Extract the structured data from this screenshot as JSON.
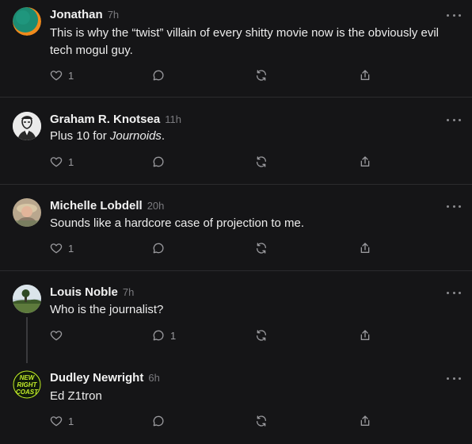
{
  "posts": [
    {
      "author": "Jonathan",
      "time": "7h",
      "text": "This is why the “twist” villain of every shitty movie now is the obviously evil tech mogul guy.",
      "likes": "1",
      "replies": "",
      "avatar": "teal-orange-circle"
    },
    {
      "author": "Graham R. Knotsea",
      "time": "11h",
      "text_plain": "Plus 10 for ",
      "text_italic": "Journoids",
      "text_end": ".",
      "likes": "1",
      "replies": "",
      "avatar": "sketch-portrait"
    },
    {
      "author": "Michelle Lobdell",
      "time": "20h",
      "text": "Sounds like a hardcore case of projection to me.",
      "likes": "1",
      "replies": "",
      "avatar": "photo-portrait"
    },
    {
      "author": "Louis Noble",
      "time": "7h",
      "text": "Who is the journalist?",
      "likes": "",
      "replies": "1",
      "avatar": "landscape-photo"
    },
    {
      "author": "Dudley Newright",
      "time": "6h",
      "text": "Ed Z1tron",
      "likes": "1",
      "replies": "",
      "avatar": "new-right-coast-logo",
      "avatar_logo_text": [
        "NEW",
        "RIGHT",
        "COAST"
      ]
    }
  ],
  "icons": {
    "like": "heart-icon",
    "reply": "speech-bubble-icon",
    "repost": "repost-arrows-icon",
    "share": "share-upload-icon",
    "more": "ellipsis-icon"
  },
  "colors": {
    "background": "#151517",
    "divider": "#2b2b2e",
    "text": "#ececec",
    "muted": "#7b7b7f",
    "icon": "#9a9a9e",
    "logo_green": "#c4ee2a"
  }
}
